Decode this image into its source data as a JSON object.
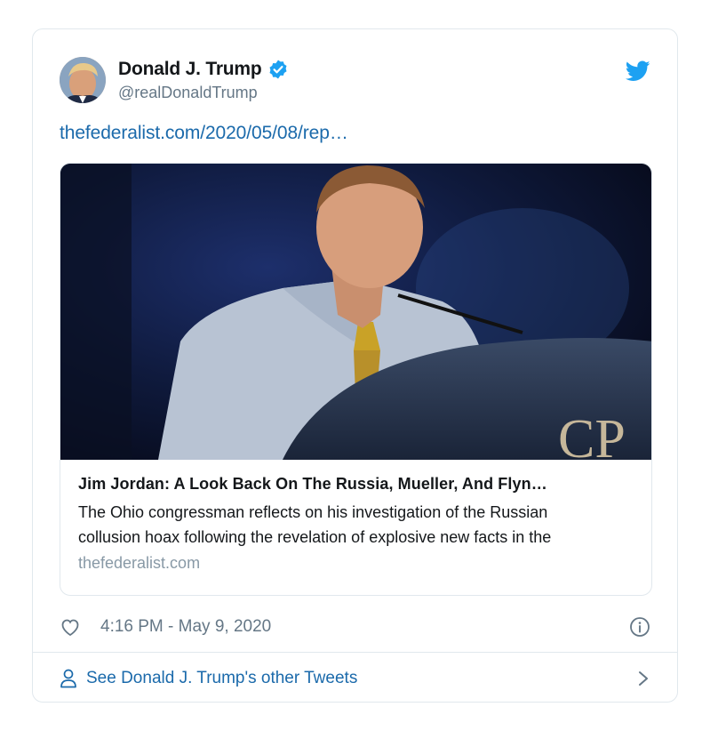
{
  "colors": {
    "link": "#1b6aab",
    "twitter_blue": "#1da1f2",
    "secondary_text": "#657786",
    "border": "#e1e8ed"
  },
  "tweet": {
    "display_name": "Donald J. Trump",
    "handle": "@realDonaldTrump",
    "verified": true,
    "link_text": "thefederalist.com/2020/05/08/rep…",
    "timestamp": "4:16 PM - May 9, 2020",
    "icons": [
      "avatar",
      "verified-badge-icon",
      "twitter-bird-icon",
      "heart-icon",
      "info-icon",
      "person-icon",
      "chevron-right-icon"
    ]
  },
  "card": {
    "title": "Jim Jordan: A Look Back On The Russia, Mueller, And Flyn…",
    "description_line1": "The Ohio congressman reflects on his investigation of the Russian",
    "description_line2": "collusion hoax following the revelation of explosive new facts in the",
    "domain": "thefederalist.com",
    "image_text": "CP"
  },
  "footer": {
    "label": "See Donald J. Trump's other Tweets"
  }
}
